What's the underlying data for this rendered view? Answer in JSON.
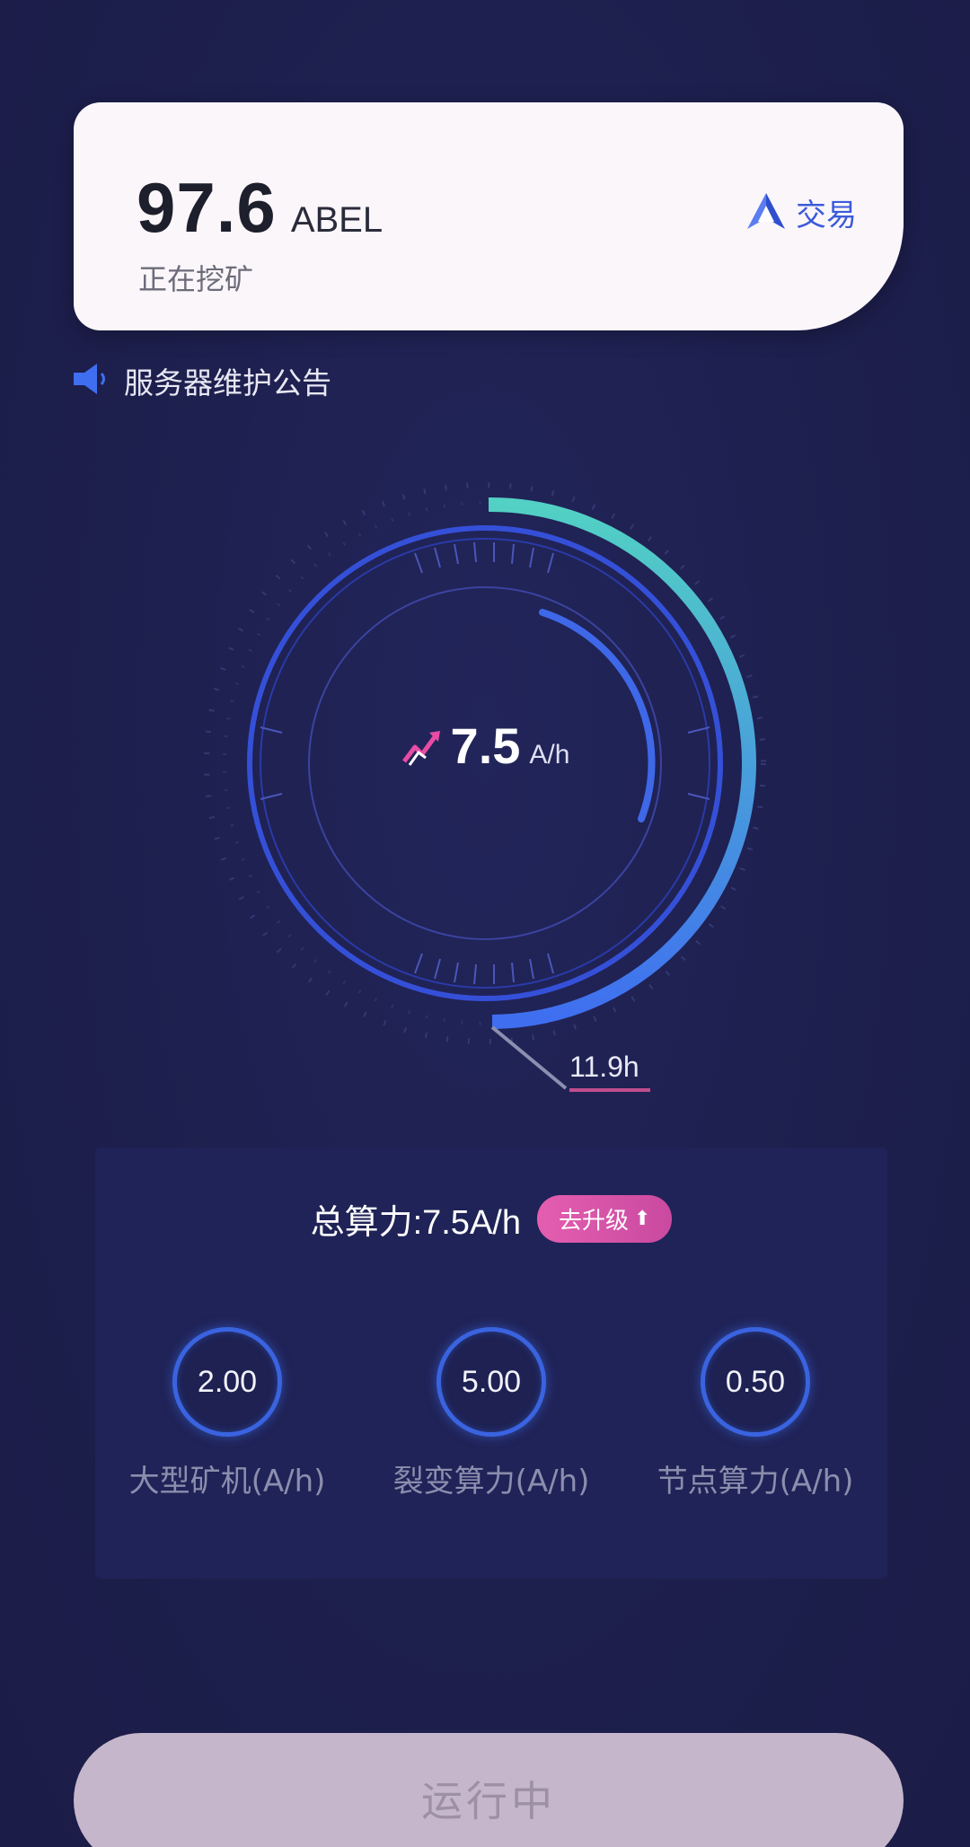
{
  "balance": {
    "value": "97.6",
    "unit": "ABEL",
    "status": "正在挖矿",
    "trade_label": "交易"
  },
  "notice": {
    "text": "服务器维护公告"
  },
  "gauge": {
    "value": "7.5",
    "unit": "A/h",
    "remaining": "11.9h",
    "progress": 0.5
  },
  "stats": {
    "total": "总算力:7.5A/h",
    "upgrade_label": "去升级",
    "items": [
      {
        "value": "2.00",
        "label": "大型矿机(A/h)"
      },
      {
        "value": "5.00",
        "label": "裂变算力(A/h)"
      },
      {
        "value": "0.50",
        "label": "节点算力(A/h)"
      }
    ]
  },
  "run_button": {
    "label": "运行中"
  },
  "colors": {
    "background": "#1d1f4d",
    "accent_blue": "#3b5bd9",
    "accent_teal": "#52d1c4",
    "accent_pink": "#e45eb0"
  }
}
